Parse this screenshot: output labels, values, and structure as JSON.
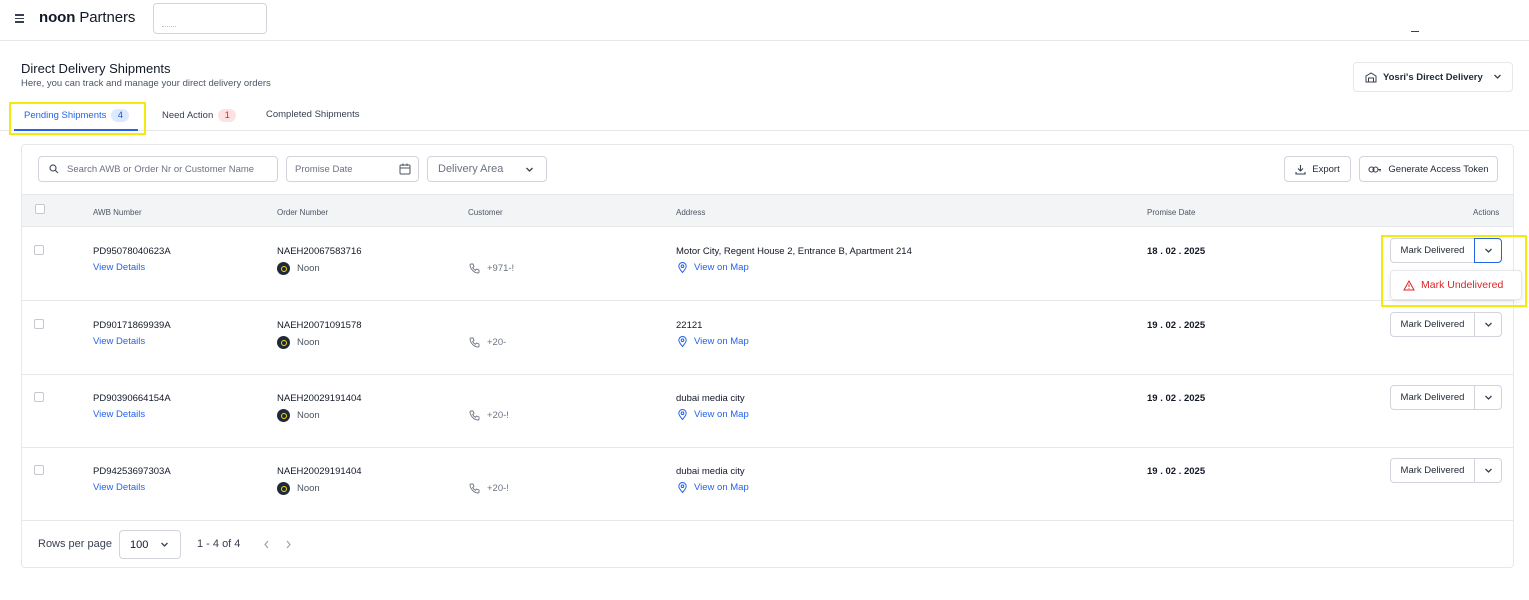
{
  "app": {
    "logo_bold": "noon",
    "logo_rest": "Partners"
  },
  "header": {
    "title": "Direct Delivery Shipments",
    "subtitle": "Here, you can track and manage your direct delivery orders",
    "store": "Yosri's Direct Delivery"
  },
  "tabs": [
    {
      "label": "Pending Shipments",
      "count": "4",
      "active": true
    },
    {
      "label": "Need Action",
      "count": "1",
      "active": false
    },
    {
      "label": "Completed Shipments",
      "active": false
    }
  ],
  "filters": {
    "search_placeholder": "Search AWB or Order Nr or Customer Name",
    "date_placeholder": "Promise Date",
    "area_placeholder": "Delivery Area",
    "export_label": "Export",
    "token_label": "Generate Access Token"
  },
  "table": {
    "columns": [
      "AWB Number",
      "Order Number",
      "Customer",
      "Address",
      "Promise Date",
      "Actions"
    ],
    "rows": [
      {
        "awb": "PD95078040623A",
        "details": "View Details",
        "order": "NAEH20067583716",
        "partner": "Noon",
        "phone": "+971-!",
        "address": "Motor City, Regent House 2, Entrance B, Apartment 214",
        "map": "View on Map",
        "date": "18 . 02 . 2025",
        "action": "Mark Delivered"
      },
      {
        "awb": "PD90171869939A",
        "details": "View Details",
        "order": "NAEH20071091578",
        "partner": "Noon",
        "phone": "+20-",
        "address": "22121",
        "map": "View on Map",
        "date": "19 . 02 . 2025",
        "action": "Mark Delivered"
      },
      {
        "awb": "PD90390664154A",
        "details": "View Details",
        "order": "NAEH20029191404",
        "partner": "Noon",
        "phone": "+20-!",
        "address": "dubai media city",
        "map": "View on Map",
        "date": "19 . 02 . 2025",
        "action": "Mark Delivered"
      },
      {
        "awb": "PD94253697303A",
        "details": "View Details",
        "order": "NAEH20029191404",
        "partner": "Noon",
        "phone": "+20-!",
        "address": "dubai media city",
        "map": "View on Map",
        "date": "19 . 02 . 2025",
        "action": "Mark Delivered"
      }
    ]
  },
  "dropdown": {
    "label": "Mark Undelivered"
  },
  "footer": {
    "rows_label": "Rows per page",
    "rows_value": "100",
    "range": "1 - 4 of 4"
  },
  "colors": {
    "accent": "#2563eb",
    "danger": "#dc2626",
    "highlight": "#f5ea10"
  }
}
